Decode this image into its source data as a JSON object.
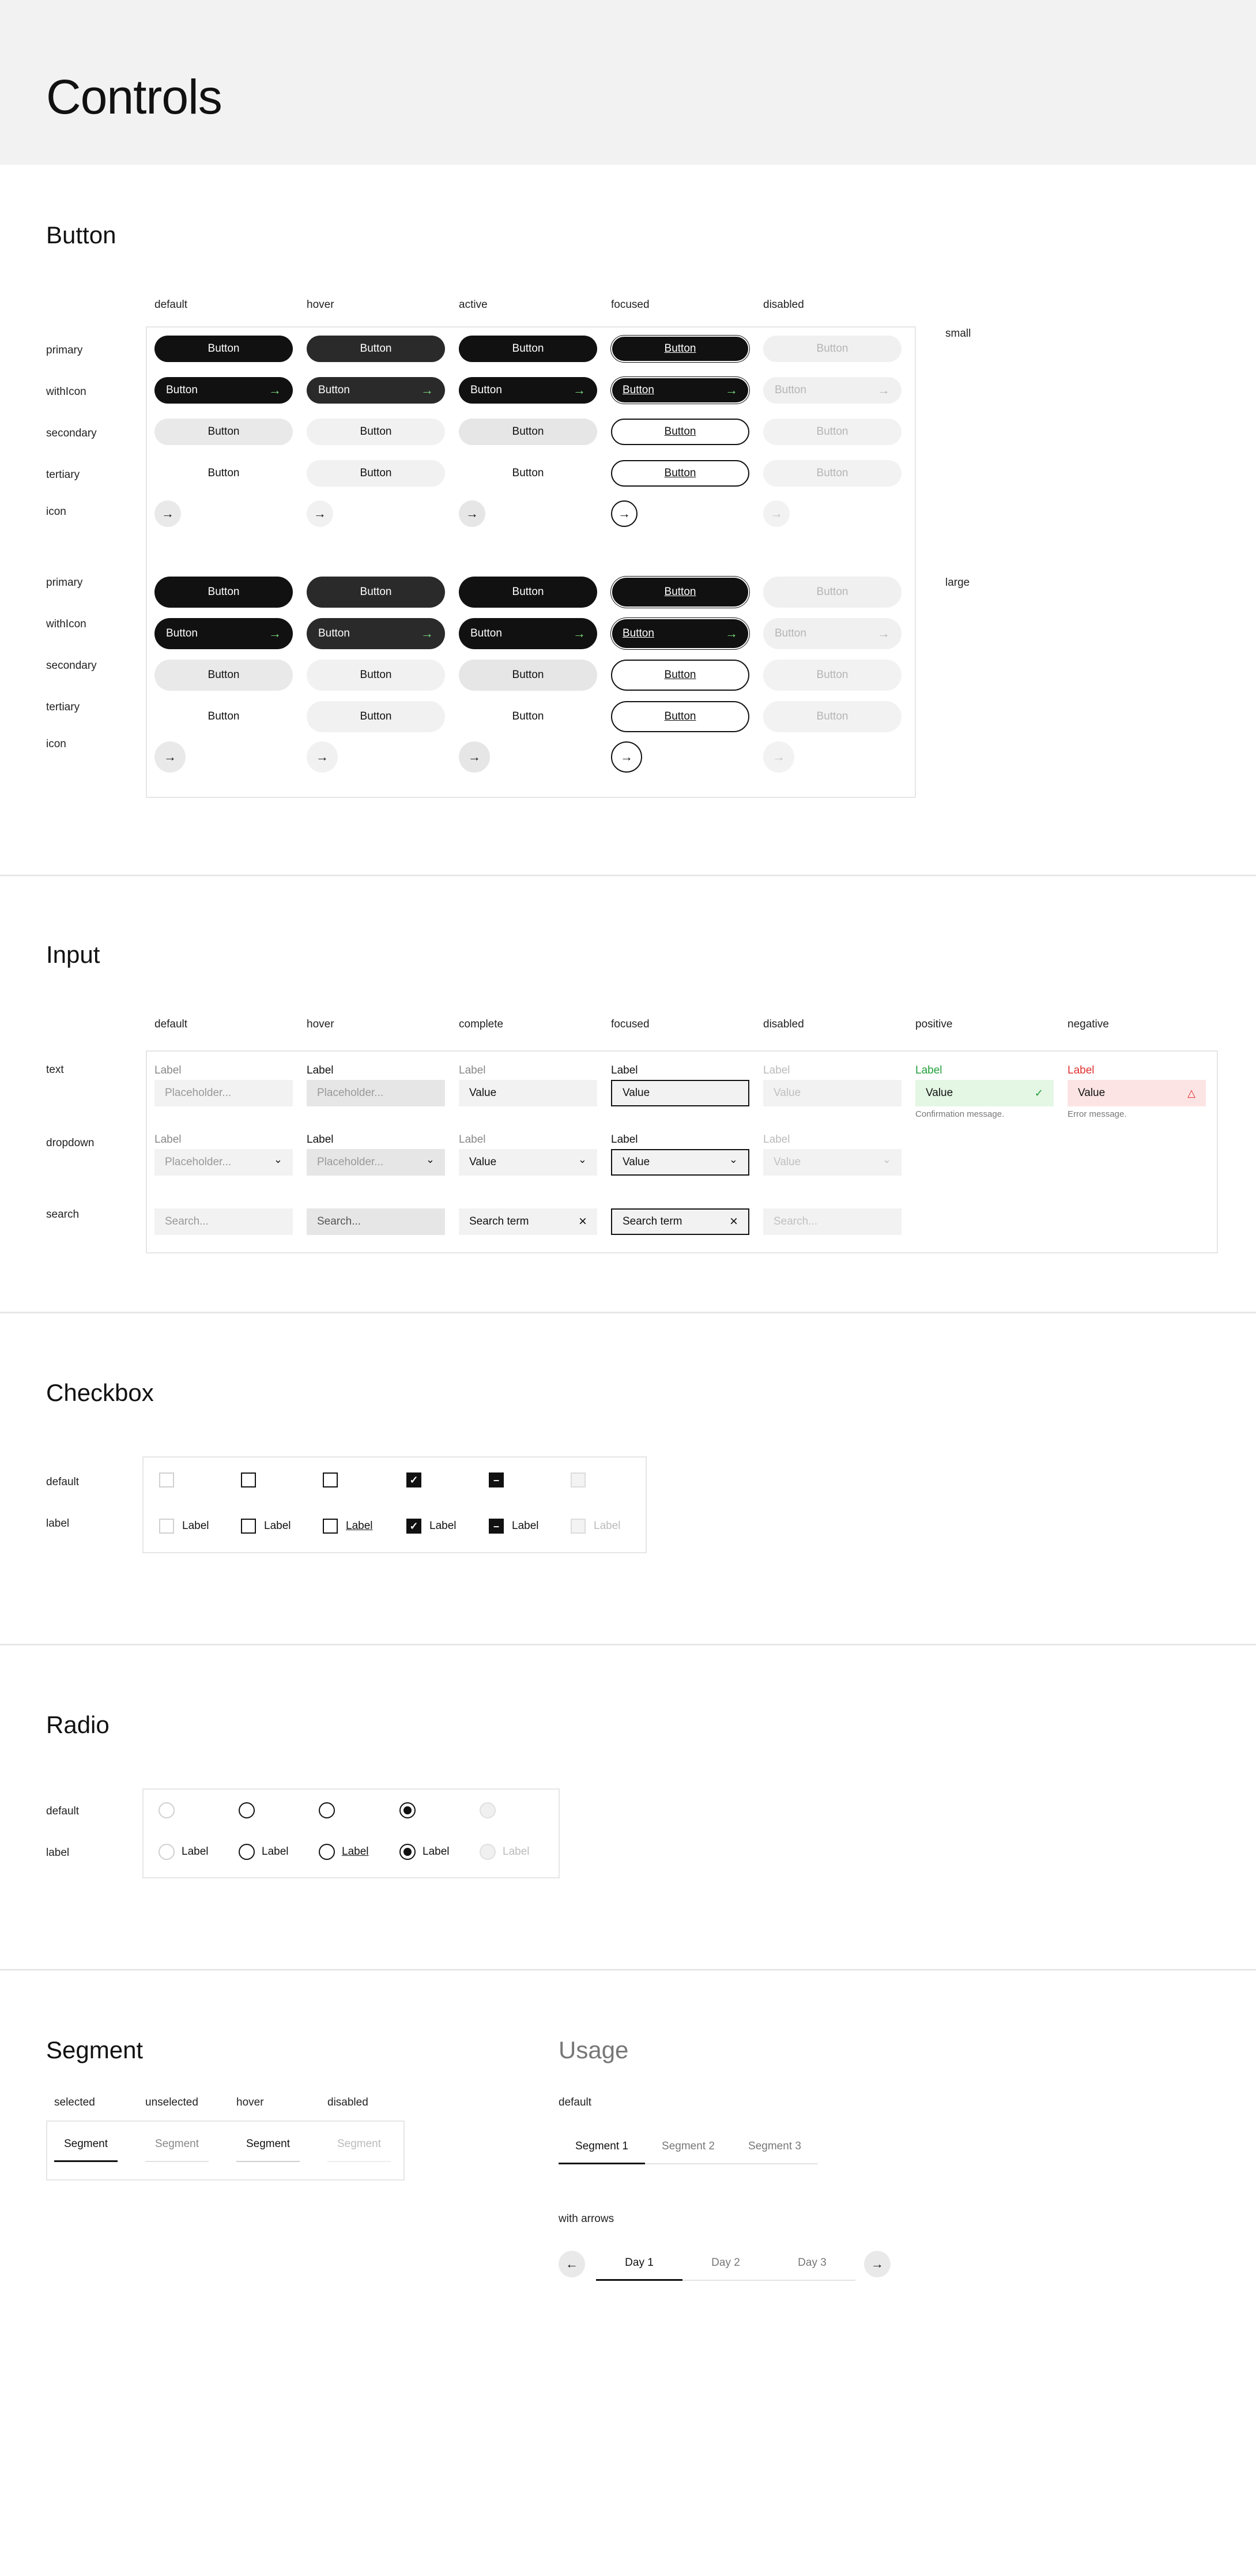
{
  "page": {
    "title": "Controls"
  },
  "button_section": {
    "title": "Button",
    "columns": [
      "default",
      "hover",
      "active",
      "focused",
      "disabled"
    ],
    "rows": [
      "primary",
      "withIcon",
      "secondary",
      "tertiary",
      "icon"
    ],
    "sizes": [
      "small",
      "large"
    ],
    "label": "Button"
  },
  "input_section": {
    "title": "Input",
    "columns": [
      "default",
      "hover",
      "complete",
      "focused",
      "disabled",
      "positive",
      "negative"
    ],
    "rows": [
      "text",
      "dropdown",
      "search"
    ],
    "field_label": "Label",
    "placeholder": "Placeholder...",
    "value": "Value",
    "search_placeholder": "Search...",
    "search_term": "Search term",
    "confirmation": "Confirmation message.",
    "error": "Error message.",
    "positive_color": "#22a03a",
    "negative_color": "#e0312f"
  },
  "checkbox_section": {
    "title": "Checkbox",
    "rows": [
      "default",
      "label"
    ],
    "label": "Label"
  },
  "radio_section": {
    "title": "Radio",
    "rows": [
      "default",
      "label"
    ],
    "label": "Label"
  },
  "segment_section": {
    "title": "Segment",
    "columns": [
      "selected",
      "unselected",
      "hover",
      "disabled"
    ],
    "label": "Segment"
  },
  "usage_section": {
    "title": "Usage",
    "default_label": "default",
    "default_segments": [
      "Segment 1",
      "Segment 2",
      "Segment 3"
    ],
    "arrows_label": "with arrows",
    "arrow_segments": [
      "Day 1",
      "Day 2",
      "Day 3"
    ]
  },
  "icons": {
    "arrow_right": "→",
    "arrow_left": "←",
    "chevron_down": "⌄",
    "close": "×",
    "check": "✓",
    "warning": "△",
    "dash": "–"
  }
}
